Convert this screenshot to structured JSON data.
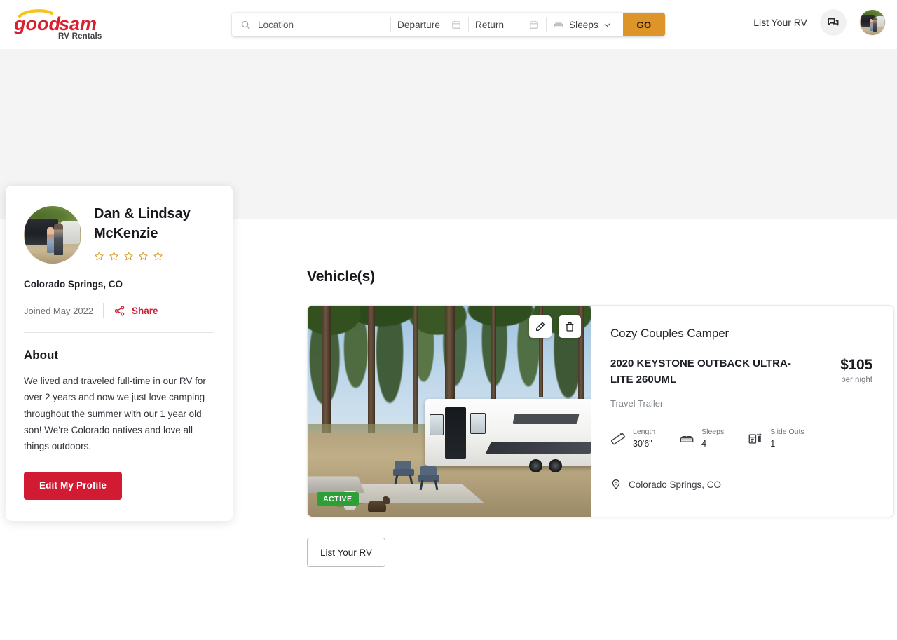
{
  "brand": {
    "name_primary": "good",
    "name_secondary": "sam",
    "tagline": "RV Rentals",
    "colors": {
      "logo_red": "#d8202f",
      "logo_swoosh": "#f5c518",
      "accent_red": "#d01b33",
      "go_orange": "#dd9428",
      "active_green": "#2e9e36",
      "star_gold": "#d9a12c"
    }
  },
  "header": {
    "search": {
      "location_placeholder": "Location",
      "departure_label": "Departure",
      "return_label": "Return",
      "sleeps_label": "Sleeps",
      "go_label": "GO",
      "icons": {
        "search": "search-icon",
        "departure_calendar": "calendar-icon",
        "return_calendar": "calendar-icon",
        "sleeps_bed": "bed-icon",
        "sleeps_chevron": "chevron-down-icon"
      }
    },
    "list_your_rv_label": "List Your RV",
    "chat_icon": "chat-bubble-icon",
    "avatar_alt": "user-avatar"
  },
  "profile": {
    "name": "Dan & Lindsay McKenzie",
    "rating": {
      "value": 0,
      "max": 5,
      "filled": 0
    },
    "location": "Colorado Springs, CO",
    "joined": "Joined May 2022",
    "share_label": "Share",
    "about_title": "About",
    "about_text": "We lived and traveled full-time in our RV for over 2 years and now we just love camping throughout the summer with our 1 year old son! We're Colorado natives and love all things outdoors.",
    "edit_button_label": "Edit My Profile"
  },
  "main": {
    "section_title": "Vehicle(s)",
    "list_rv_button_label": "List Your RV",
    "vehicles": [
      {
        "status_badge": "ACTIVE",
        "nickname": "Cozy Couples Camper",
        "model": "2020 KEYSTONE OUTBACK ULTRA-LITE 260UML",
        "type": "Travel Trailer",
        "price": "$105",
        "price_unit": "per night",
        "location": "Colorado Springs, CO",
        "specs": [
          {
            "icon": "ruler-icon",
            "label": "Length",
            "value": "30'6\""
          },
          {
            "icon": "bed-icon",
            "label": "Sleeps",
            "value": "4"
          },
          {
            "icon": "slideout-icon",
            "label": "Slide Outs",
            "value": "1"
          }
        ],
        "actions": [
          {
            "icon": "pencil-icon",
            "name": "edit-vehicle-button"
          },
          {
            "icon": "trash-icon",
            "name": "delete-vehicle-button"
          }
        ]
      }
    ]
  }
}
